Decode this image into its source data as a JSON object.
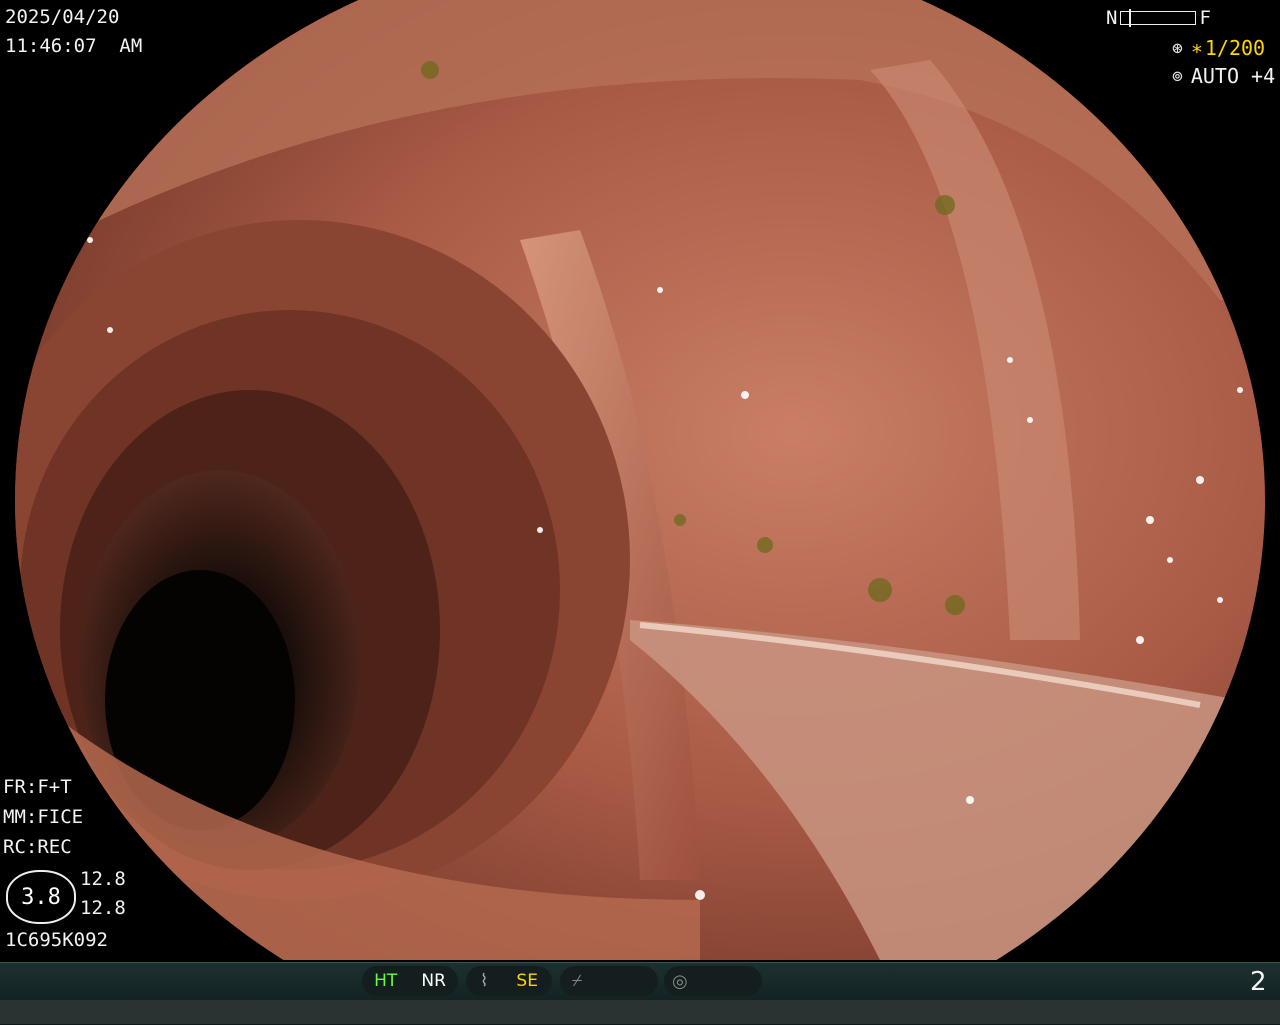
{
  "overlay": {
    "date": "2025/04/20",
    "time": "11:46:07  AM",
    "near_label": "N",
    "far_label": "F",
    "shutter": "1/200",
    "iris_mode": "AUTO +4",
    "frame_mode": "FR:F+T",
    "mm_mode": "MM:FICE",
    "rc_mode": "RC:REC",
    "zoom_badge": "3.8",
    "value_top": "12.8",
    "value_bottom": "12.8",
    "scope_id": "1C695K092"
  },
  "status_bar": {
    "ht_label": "HT",
    "nr_label": "NR",
    "se_label": "SE",
    "page_number": "2"
  },
  "colors": {
    "accent_yellow": "#ffd500",
    "accent_green": "#66ff33",
    "mucosa": "#b0624a"
  }
}
